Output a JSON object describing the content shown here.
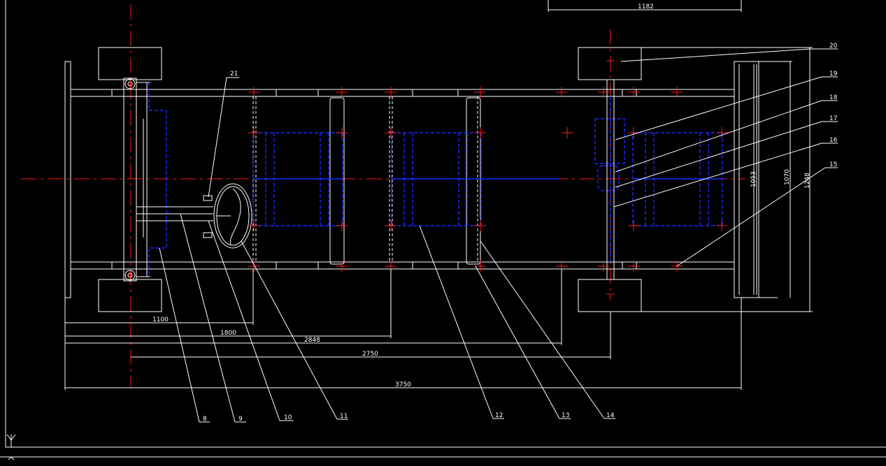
{
  "dimensions": {
    "top": "1182",
    "d1100": "1100",
    "d1800": "1800",
    "d2848": "2848",
    "d2750": "2750",
    "d3750": "3750",
    "v1053": "1053",
    "v1070": "1070",
    "v1248": "1248"
  },
  "callouts": {
    "c8": "8",
    "c9": "9",
    "c10": "10",
    "c11": "11",
    "c12": "12",
    "c13": "13",
    "c14": "14",
    "c15": "15",
    "c16": "16",
    "c17": "17",
    "c18": "18",
    "c19": "19",
    "c20": "20",
    "c21": "21"
  },
  "ucs": {
    "axis_y": "Y"
  },
  "colors": {
    "centerline": "#ff1a1a",
    "hidden": "#1c2cff",
    "geometry": "#ffffff",
    "background": "#000000"
  }
}
